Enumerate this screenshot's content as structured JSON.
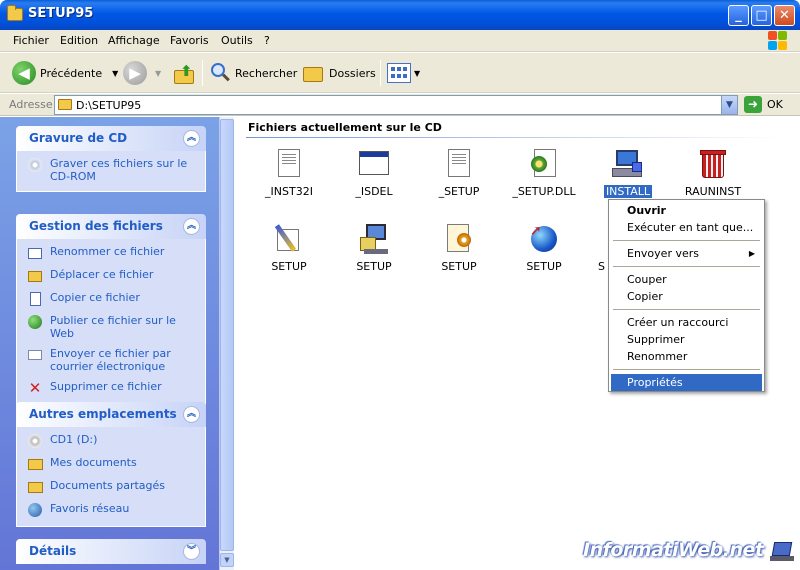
{
  "window": {
    "title": "SETUP95"
  },
  "menu": [
    "Fichier",
    "Edition",
    "Affichage",
    "Favoris",
    "Outils",
    "?"
  ],
  "toolbar": {
    "back_label": "Précédente",
    "search_label": "Rechercher",
    "folders_label": "Dossiers"
  },
  "address": {
    "label": "Adresse",
    "value": "D:\\SETUP95",
    "go_label": "OK"
  },
  "tasks": {
    "cd": {
      "title": "Gravure de CD",
      "links": [
        "Graver ces fichiers sur le CD-ROM"
      ]
    },
    "files": {
      "title": "Gestion des fichiers",
      "links": [
        "Renommer ce fichier",
        "Déplacer ce fichier",
        "Copier ce fichier",
        "Publier ce fichier sur le Web",
        "Envoyer ce fichier par courrier électronique",
        "Supprimer ce fichier"
      ]
    },
    "places": {
      "title": "Autres emplacements",
      "links": [
        "CD1 (D:)",
        "Mes documents",
        "Documents partagés",
        "Favoris réseau"
      ]
    },
    "details": {
      "title": "Détails"
    }
  },
  "main": {
    "section_title": "Fichiers actuellement sur le CD",
    "files": [
      {
        "name": "_INST32I",
        "icon": "document-window-icon"
      },
      {
        "name": "_ISDEL",
        "icon": "application-window-icon"
      },
      {
        "name": "_SETUP",
        "icon": "document-window-icon"
      },
      {
        "name": "_SETUP.DLL",
        "icon": "dll-gear-icon"
      },
      {
        "name": "INSTALL",
        "icon": "install-computer-icon",
        "selected": true
      },
      {
        "name": "RAUNINST",
        "icon": "uninstall-trash-icon"
      },
      {
        "name": "SETUP",
        "icon": "paint-brush-icon"
      },
      {
        "name": "SETUP",
        "icon": "setup-computer-icon"
      },
      {
        "name": "SETUP",
        "icon": "setup-gear-document-icon"
      },
      {
        "name": "SETUP",
        "icon": "globe-cursor-icon"
      },
      {
        "name": "S",
        "icon": "partial-icon"
      }
    ]
  },
  "context_menu": {
    "items": [
      {
        "label": "Ouvrir",
        "bold": true
      },
      {
        "label": "Exécuter en tant que..."
      },
      {
        "label": "Envoyer vers",
        "submenu": true
      },
      {
        "label": "Couper"
      },
      {
        "label": "Copier"
      },
      {
        "label": "Créer un raccourci"
      },
      {
        "label": "Supprimer"
      },
      {
        "label": "Renommer"
      },
      {
        "label": "Propriétés",
        "highlighted": true
      }
    ]
  },
  "watermark": "InformatiWeb.net",
  "colors": {
    "title_bar": "#0058e6",
    "task_pane": "#7ba2e7",
    "selection": "#316ac5",
    "link": "#215dc6"
  }
}
